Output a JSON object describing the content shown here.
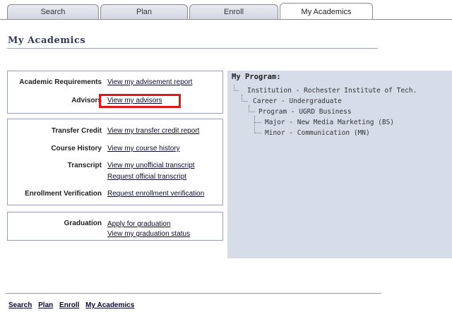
{
  "tabs": [
    {
      "label": "Search"
    },
    {
      "label": "Plan"
    },
    {
      "label": "Enroll"
    },
    {
      "label": "My Academics"
    }
  ],
  "page_title": "My Academics",
  "group1": {
    "rows": [
      {
        "label": "Academic Requirements",
        "links": [
          "View my advisement report"
        ]
      },
      {
        "label": "Advisors",
        "links": [
          "View my advisors"
        ]
      }
    ]
  },
  "group2": {
    "rows": [
      {
        "label": "Transfer Credit",
        "links": [
          "View my transfer credit report"
        ]
      },
      {
        "label": "Course History",
        "links": [
          "View my course history"
        ]
      },
      {
        "label": "Transcript",
        "links": [
          "View my unofficial transcript",
          "Request official transcript"
        ]
      },
      {
        "label": "Enrollment Verification",
        "links": [
          "Request enrollment verification"
        ]
      }
    ]
  },
  "group3": {
    "rows": [
      {
        "label": "Graduation",
        "links": [
          "Apply for graduation",
          "View my graduation status"
        ]
      }
    ]
  },
  "program": {
    "title": "My Program:",
    "items": [
      "Institution - Rochester Institute of Tech.",
      "Career - Undergraduate",
      "Program - UGRD Business",
      "Major - New Media Marketing (BS)",
      "Minor - Communication (MN)"
    ]
  },
  "footer_nav": [
    "Search",
    "Plan",
    "Enroll",
    "My Academics"
  ],
  "colors": {
    "highlight": "#e01818",
    "program_bg": "#d6dde8"
  }
}
